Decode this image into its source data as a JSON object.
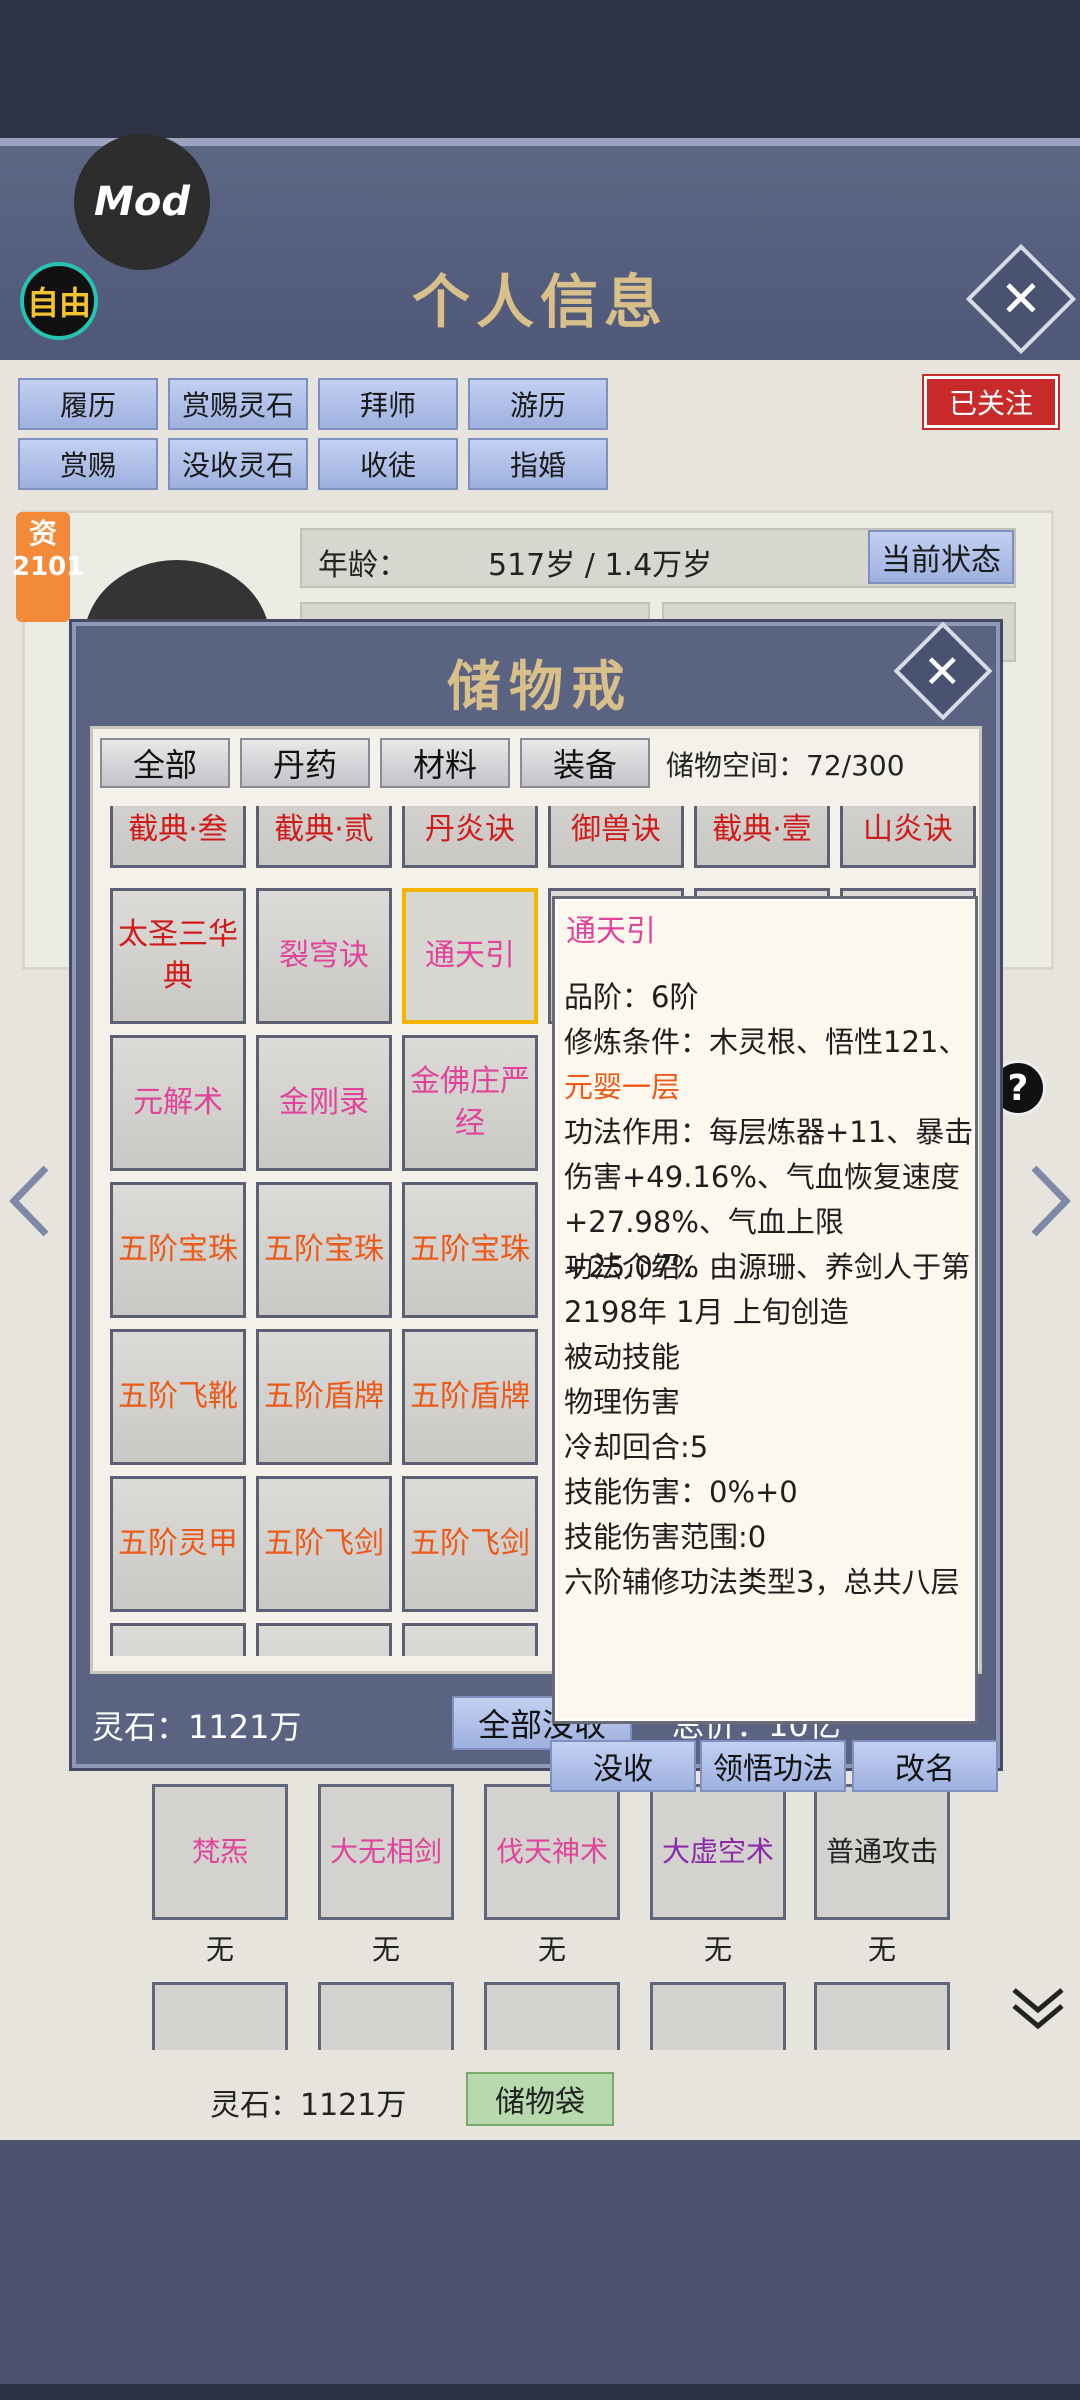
{
  "header": {
    "mod_label": "Mod",
    "mode_label": "自由",
    "title": "个人信息"
  },
  "actions_row1": [
    "履历",
    "赏赐灵石",
    "拜师",
    "游历"
  ],
  "actions_row2": [
    "赏赐",
    "没收灵石",
    "收徒",
    "指婚"
  ],
  "follow_label": "已关注",
  "profile": {
    "zi_label": "资",
    "zi_value": "2101",
    "age_label": "年龄：",
    "age_value": "517岁 / 1.4万岁",
    "status_button": "当前状态"
  },
  "skills": [
    {
      "name": "梵炁",
      "color": "#e0449a",
      "level": "无"
    },
    {
      "name": "大无相剑",
      "color": "#e0449a",
      "level": "无"
    },
    {
      "name": "伐天神术",
      "color": "#e0449a",
      "level": "无"
    },
    {
      "name": "大虚空术",
      "color": "#8a2aa8",
      "level": "无"
    },
    {
      "name": "普通攻击",
      "color": "#222222",
      "level": "无"
    }
  ],
  "footer": {
    "spirit_stones": "灵石：1121万",
    "bag_button": "储物袋"
  },
  "ring": {
    "title": "储物戒",
    "categories": [
      "全部",
      "丹药",
      "材料",
      "装备"
    ],
    "capacity": "储物空间：72/300",
    "partial_top_row": [
      {
        "name": "截典·叁",
        "color": "red"
      },
      {
        "name": "截典·贰",
        "color": "red"
      },
      {
        "name": "丹炎诀",
        "color": "red"
      },
      {
        "name": "御兽诀",
        "color": "red"
      },
      {
        "name": "截典·壹",
        "color": "red"
      },
      {
        "name": "山炎诀",
        "color": "red"
      }
    ],
    "items": [
      {
        "name": "太圣三华典",
        "color": "red"
      },
      {
        "name": "裂穹诀",
        "color": "pink"
      },
      {
        "name": "通天引",
        "color": "pink",
        "selected": true
      },
      {
        "name": "元解术",
        "color": "pink"
      },
      {
        "name": "金刚录",
        "color": "pink"
      },
      {
        "name": "金佛庄严经",
        "color": "pink"
      },
      {
        "name": "五阶宝珠",
        "color": "orange"
      },
      {
        "name": "五阶宝珠",
        "color": "orange"
      },
      {
        "name": "五阶宝珠",
        "color": "orange"
      },
      {
        "name": "五阶飞靴",
        "color": "orange"
      },
      {
        "name": "五阶盾牌",
        "color": "orange"
      },
      {
        "name": "五阶盾牌",
        "color": "orange"
      },
      {
        "name": "五阶灵甲",
        "color": "orange"
      },
      {
        "name": "五阶飞剑",
        "color": "orange"
      },
      {
        "name": "五阶飞剑",
        "color": "orange"
      }
    ],
    "spirit_stones": "灵石：1121万",
    "confiscate_all": "全部没收",
    "total_value": "总价：10亿"
  },
  "tooltip": {
    "title": "通天引",
    "grade": "品阶：6阶",
    "requirement_prefix": "修炼条件：木灵根、悟性121、",
    "requirement_highlight": "元婴一层",
    "effect": "功法作用：每层炼器+11、暴击伤害+49.16%、气血恢复速度+27.98%、气血上限+25.07%",
    "intro": "功法介绍：由源珊、养剑人于第2198年 1月 上旬创造",
    "passive": "被动技能",
    "damage_type": "物理伤害",
    "cooldown": "冷却回合:5",
    "skill_damage": "技能伤害：0%+0",
    "skill_range": "技能伤害范围:0",
    "category": "六阶辅修功法类型3，总共八层",
    "actions": [
      "没收",
      "领悟功法",
      "改名"
    ]
  }
}
